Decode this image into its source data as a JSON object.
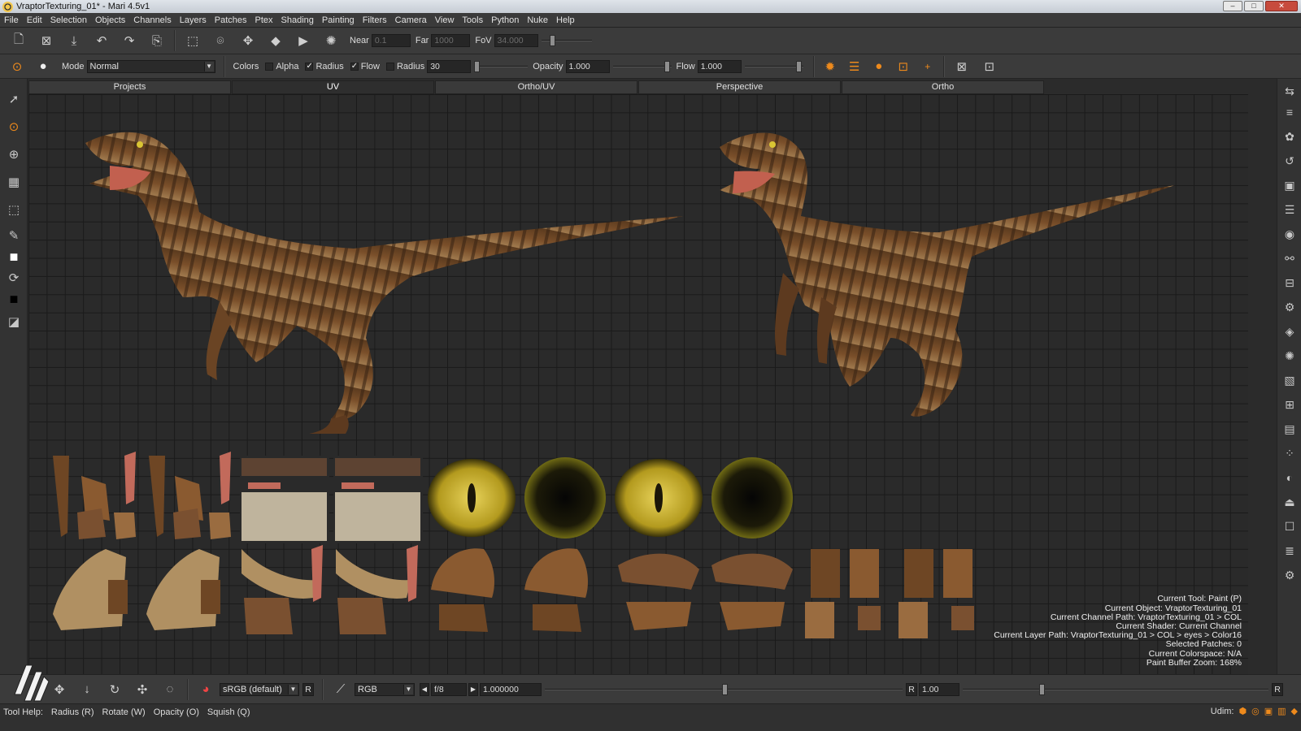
{
  "window": {
    "title": "VraptorTexturing_01* - Mari 4.5v1"
  },
  "menu": [
    "File",
    "Edit",
    "Selection",
    "Objects",
    "Channels",
    "Layers",
    "Patches",
    "Ptex",
    "Shading",
    "Painting",
    "Filters",
    "Camera",
    "View",
    "Tools",
    "Python",
    "Nuke",
    "Help"
  ],
  "camera_bar": {
    "near_label": "Near",
    "near_value": "0.1",
    "far_label": "Far",
    "far_value": "1000",
    "fov_label": "FoV",
    "fov_value": "34.000"
  },
  "paint_bar": {
    "mode_label": "Mode",
    "mode_value": "Normal",
    "colors_label": "Colors",
    "alpha_label": "Alpha",
    "radius_check_label": "Radius",
    "flow_check_label": "Flow",
    "radius_label": "Radius",
    "radius_value": "30",
    "opacity_label": "Opacity",
    "opacity_value": "1.000",
    "flow_label": "Flow",
    "flow_value": "1.000"
  },
  "tabs": [
    "Projects",
    "UV",
    "Ortho/UV",
    "Perspective",
    "Ortho"
  ],
  "active_tab": "UV",
  "hud": {
    "tool": "Current Tool: Paint (P)",
    "object": "Current Object: VraptorTexturing_01",
    "channel": "Current Channel Path: VraptorTexturing_01 > COL",
    "shader": "Current Shader: Current Channel",
    "layer": "Current Layer Path: VraptorTexturing_01 > COL > eyes > Color16",
    "patches": "Selected Patches: 0",
    "colorspace": "Current Colorspace: N/A",
    "zoom": "Paint Buffer Zoom: 168%"
  },
  "bottom_bar": {
    "colorspace_value": "sRGB (default)",
    "r_button": "R",
    "channel_value": "RGB",
    "fstop_value": "f/8",
    "exposure_value": "1.000000",
    "gain_r": "R",
    "gain_value": "1.00",
    "right_r": "R"
  },
  "status": {
    "tool_help": "Tool Help:",
    "h1": "Radius (R)",
    "h2": "Rotate (W)",
    "h3": "Opacity (O)",
    "h4": "Squish (Q)",
    "udim_label": "Udim:"
  },
  "colors": {
    "accent": "#ee8a1c",
    "viewport_bg": "#2a2a2a",
    "grid": "#1a1a1a"
  }
}
